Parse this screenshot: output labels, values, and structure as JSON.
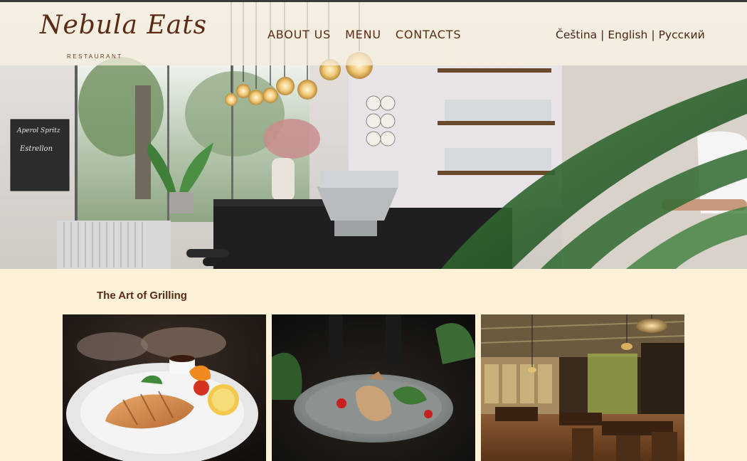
{
  "brand": {
    "name": "Nebula Eats",
    "tagline": "RESTAURANT"
  },
  "nav": {
    "items": [
      {
        "label": "ABOUT US"
      },
      {
        "label": "MENU"
      },
      {
        "label": "CONTACTS"
      }
    ]
  },
  "languages": {
    "items": [
      "Čeština",
      "English",
      "Русский"
    ],
    "separator": "|"
  },
  "hero": {
    "icon": "restaurant-bar-photo"
  },
  "section": {
    "title": "The Art of Grilling",
    "images": [
      {
        "icon": "grilled-salmon-photo"
      },
      {
        "icon": "roast-chicken-plate-photo"
      },
      {
        "icon": "restaurant-interior-photo"
      }
    ]
  },
  "colors": {
    "background": "#fdf1d8",
    "brand_brown": "#5a2a14"
  }
}
